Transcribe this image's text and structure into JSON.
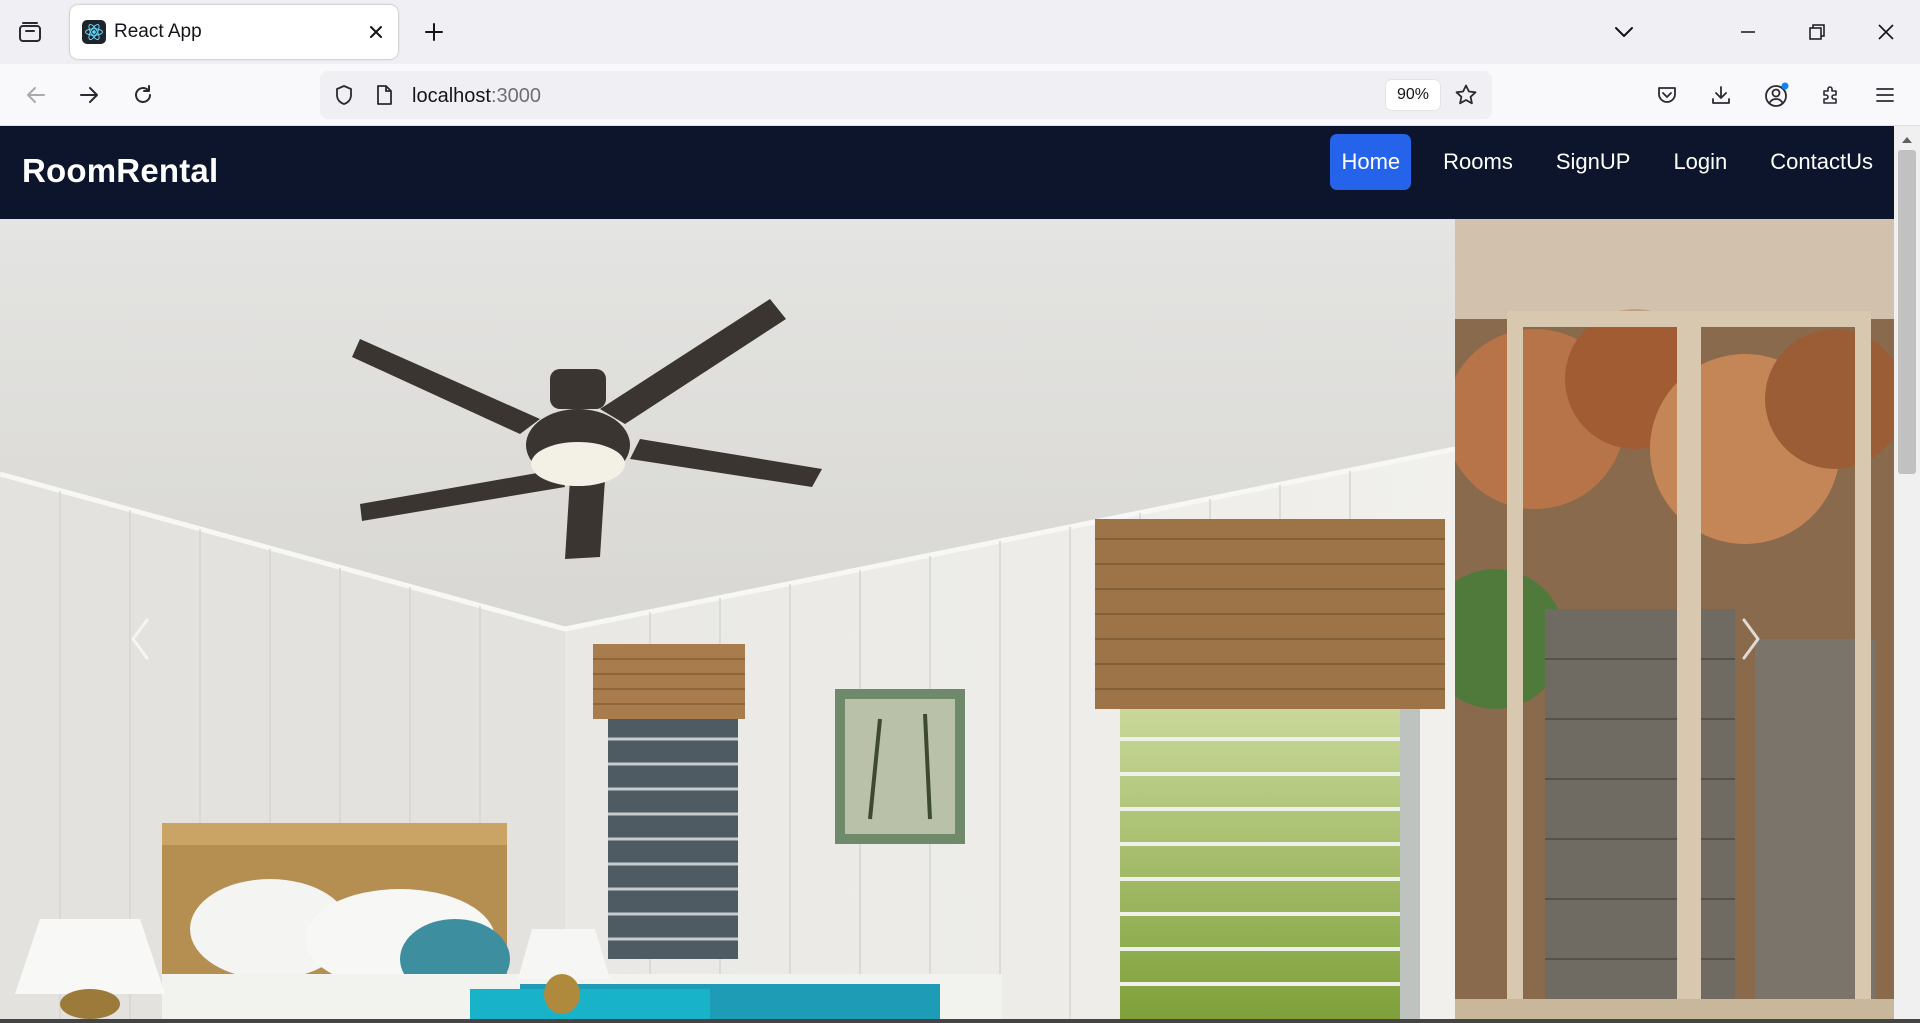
{
  "browser": {
    "tab": {
      "title": "React App",
      "favicon": "react-logo-icon"
    },
    "url": {
      "host": "localhost",
      "port": ":3000"
    },
    "zoom": "90%",
    "toolbar_icons": [
      "back-arrow-icon",
      "forward-arrow-icon",
      "reload-icon",
      "shield-icon",
      "page-icon",
      "bookmark-star-icon",
      "pocket-icon",
      "download-icon",
      "account-icon",
      "extensions-icon",
      "menu-icon"
    ],
    "window_icons": [
      "tab-list-icon",
      "minimize-icon",
      "restore-icon",
      "close-icon"
    ]
  },
  "site": {
    "brand": "RoomRental",
    "nav": [
      {
        "label": "Home",
        "active": true
      },
      {
        "label": "Rooms",
        "active": false
      },
      {
        "label": "SignUP",
        "active": false
      },
      {
        "label": "Login",
        "active": false
      },
      {
        "label": "ContactUs",
        "active": false
      }
    ],
    "carousel": {
      "prev_icon": "chevron-left-icon",
      "next_icon": "chevron-right-icon"
    },
    "colors": {
      "navbar_bg": "#0c152b",
      "active_link_bg": "#2563eb",
      "text": "#ffffff"
    }
  }
}
